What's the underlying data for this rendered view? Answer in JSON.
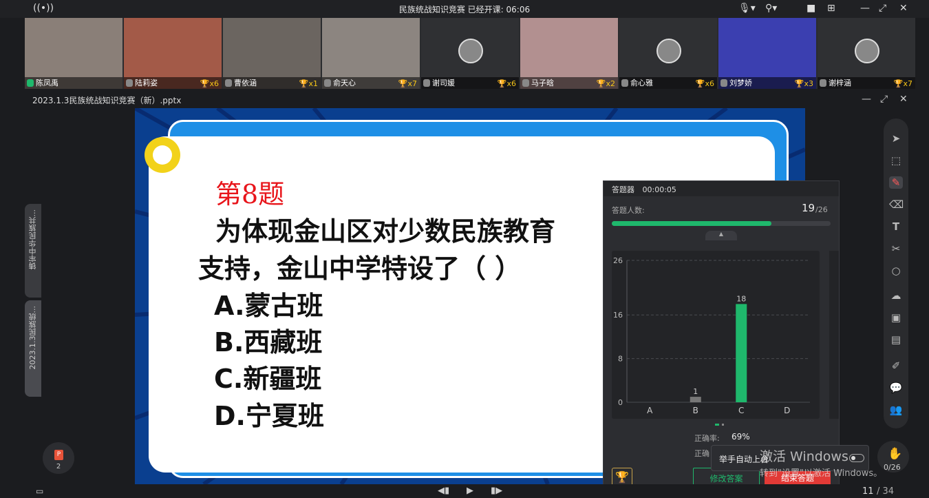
{
  "titlebar": {
    "title": "民族统战知识竞赛    已经开课: 06:06"
  },
  "participants": [
    {
      "name": "陈凤禹",
      "trophy": "",
      "bg": "#8a7f78"
    },
    {
      "name": "陆莉姿",
      "trophy": "x6",
      "bg": "#a35a48"
    },
    {
      "name": "曹依涵",
      "trophy": "x1",
      "bg": "#6b6560"
    },
    {
      "name": "俞天心",
      "trophy": "x7",
      "bg": "#8c8580"
    },
    {
      "name": "谢司媛",
      "trophy": "x6",
      "bg": "#2f3033"
    },
    {
      "name": "马子晗",
      "trophy": "x2",
      "bg": "#b29090"
    },
    {
      "name": "俞心雅",
      "trophy": "x6",
      "bg": "#2f3033"
    },
    {
      "name": "刘梦娇",
      "trophy": "x3",
      "bg": "#3b3fb0"
    },
    {
      "name": "谢梓涵",
      "trophy": "x7",
      "bg": "#2f3033"
    }
  ],
  "doc": {
    "title": "2023.1.3民族统战知识竞赛（新）.pptx"
  },
  "sidetabs": [
    "铸牢中华民族共...",
    "2023.1.3民族统..."
  ],
  "slide": {
    "qnum": "第8题",
    "line1": "为体现金山区对少数民族教育",
    "line2": "支持，金山中学特设了（      ）",
    "options": [
      "A.蒙古班",
      "B.西藏班",
      "C.新疆班",
      "D.宁夏班"
    ]
  },
  "panel": {
    "title": "答题器",
    "timer": "00:00:05",
    "answered_label": "答题人数:",
    "answered": "19",
    "total": "/26",
    "correct_label": "正确率:",
    "correct_rate": "69%",
    "correct_label2": "正确",
    "raise_hand": "举手自动上台",
    "modify_btn": "修改答案",
    "end_btn": "结束答题"
  },
  "chart_data": {
    "type": "bar",
    "categories": [
      "A",
      "B",
      "C",
      "D"
    ],
    "values": [
      0,
      1,
      18,
      0
    ],
    "yticks": [
      0,
      8,
      16,
      26
    ],
    "ylim": [
      0,
      26
    ],
    "bar_color": "#1fb86c",
    "title": "",
    "xlabel": "",
    "ylabel": ""
  },
  "overlay": {
    "activate1": "激活 Windows",
    "activate2": "转到\"设置\"以激活 Windows。"
  },
  "bottom": {
    "page": "11",
    "pages": "/ 34",
    "ppt_count": "2",
    "hand_count": "0/26"
  }
}
